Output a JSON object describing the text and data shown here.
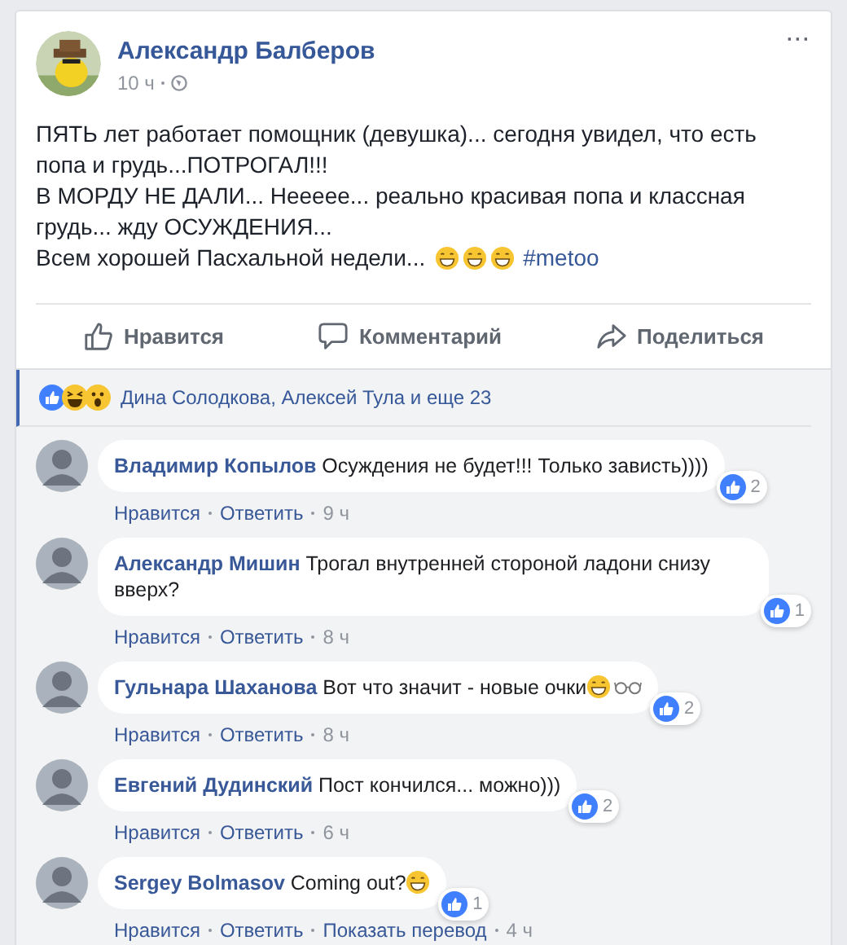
{
  "post": {
    "author": "Александр Балберов",
    "time": "10 ч",
    "more": "···",
    "paragraphs": [
      "ПЯТЬ лет работает помощник (девушка)... сегодня увидел, что есть попа и грудь...ПОТРОГАЛ!!!",
      "В МОРДУ НЕ ДАЛИ... Неееее... реально красивая попа и классная грудь... жду ОСУЖДЕНИЯ...",
      "Всем хорошей Пасхальной недели..."
    ],
    "emojis": [
      {
        "kind": "grin"
      },
      {
        "kind": "grin"
      },
      {
        "kind": "grin"
      }
    ],
    "hashtag": "#metoo"
  },
  "actions": [
    {
      "kind": "like",
      "label": "Нравится"
    },
    {
      "kind": "comment",
      "label": "Комментарий"
    },
    {
      "kind": "share",
      "label": "Поделиться"
    }
  ],
  "reactions": {
    "icons": [
      {
        "kind": "like"
      },
      {
        "kind": "haha"
      },
      {
        "kind": "wow"
      }
    ],
    "text": "Дина Солодкова, Алексей Тула и еще 23"
  },
  "comments": [
    {
      "author": "Владимир Копылов",
      "text": "Осуждения не будет!!! Только зависть))))",
      "likes": "2",
      "links": [
        "Нравится",
        "Ответить"
      ],
      "time": "9 ч"
    },
    {
      "author": "Александр Мишин",
      "text": "Трогал внутренней стороной ладони снизу вверх?",
      "likes": "1",
      "links": [
        "Нравится",
        "Ответить"
      ],
      "time": "8 ч"
    },
    {
      "author": "Гульнара Шаханова",
      "text": "Вот что значит - новые очки",
      "emojis": [
        {
          "kind": "grin"
        },
        {
          "kind": "glasses"
        }
      ],
      "likes": "2",
      "links": [
        "Нравится",
        "Ответить"
      ],
      "time": "8 ч"
    },
    {
      "author": "Евгений Дудинский",
      "text": "Пост кончился... можно)))",
      "likes": "2",
      "links": [
        "Нравится",
        "Ответить"
      ],
      "time": "6 ч"
    },
    {
      "author": "Sergey Bolmasov",
      "text": "Coming out?",
      "emojis": [
        {
          "kind": "grin"
        }
      ],
      "likes": "1",
      "links": [
        "Нравится",
        "Ответить",
        "Показать перевод"
      ],
      "time": "4 ч"
    }
  ]
}
